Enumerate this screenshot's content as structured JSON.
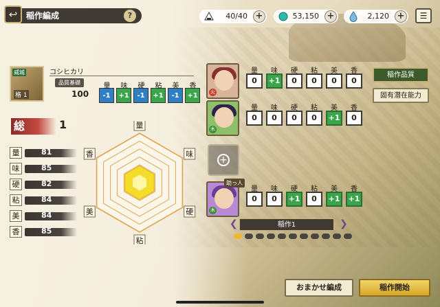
{
  "header": {
    "back_icon": "back-arrow-icon",
    "title": "稲作編成",
    "help_label": "?"
  },
  "resources": [
    {
      "name": "rice-ball",
      "value": "40/40"
    },
    {
      "name": "gem",
      "value": "53,150"
    },
    {
      "name": "water-drop",
      "value": "2,120"
    }
  ],
  "rice": {
    "tag": "威城",
    "grade": "格 1",
    "name": "コシヒカリ",
    "base_label": "品質基礎",
    "base_value": "100",
    "stats": [
      "量",
      "味",
      "硬",
      "粘",
      "美",
      "香"
    ],
    "modifiers": [
      "-1",
      "+1",
      "-1",
      "+1",
      "-1",
      "+1"
    ],
    "modifier_types": [
      "neg",
      "pos",
      "neg",
      "pos",
      "neg",
      "pos"
    ]
  },
  "rank": {
    "label": "総",
    "value": "1"
  },
  "stat_values": [
    {
      "label": "量",
      "value": "81"
    },
    {
      "label": "味",
      "value": "85"
    },
    {
      "label": "硬",
      "value": "82"
    },
    {
      "label": "粘",
      "value": "84"
    },
    {
      "label": "美",
      "value": "84"
    },
    {
      "label": "香",
      "value": "85"
    }
  ],
  "radar": {
    "labels": [
      "量",
      "味",
      "硬",
      "粘",
      "美",
      "香"
    ]
  },
  "characters": [
    {
      "name": "character-1",
      "element": "火",
      "hair": "#8a2f2f",
      "bg": "#d9b49a",
      "values": [
        "0",
        "+1",
        "0",
        "0",
        "0",
        "0"
      ],
      "types": [
        "plain",
        "pos",
        "plain",
        "plain",
        "plain",
        "plain"
      ]
    },
    {
      "name": "character-2",
      "element": "木",
      "hair": "#2d2448",
      "bg": "#8fbf6a",
      "values": [
        "0",
        "0",
        "0",
        "0",
        "+1",
        "0"
      ],
      "types": [
        "plain",
        "plain",
        "plain",
        "plain",
        "pos",
        "plain"
      ]
    },
    {
      "name": "character-3",
      "element": "木",
      "hair": "#6a3f93",
      "bg": "#b88ad6",
      "helper": "助っ人",
      "values": [
        "0",
        "0",
        "+1",
        "0",
        "+1",
        "+1"
      ],
      "types": [
        "plain",
        "plain",
        "pos",
        "plain",
        "pos",
        "pos"
      ]
    }
  ],
  "tray": {
    "name": "稲作1",
    "page_count": 11,
    "active_page": 0
  },
  "side_buttons": {
    "quality": "稲作品質",
    "potential": "固有潜在能力"
  },
  "bottom_buttons": {
    "auto": "おまかせ編成",
    "start": "稲作開始"
  },
  "colors": {
    "positive": "#3aa54a",
    "negative": "#2f7fc4",
    "accent": "#f0b830"
  }
}
